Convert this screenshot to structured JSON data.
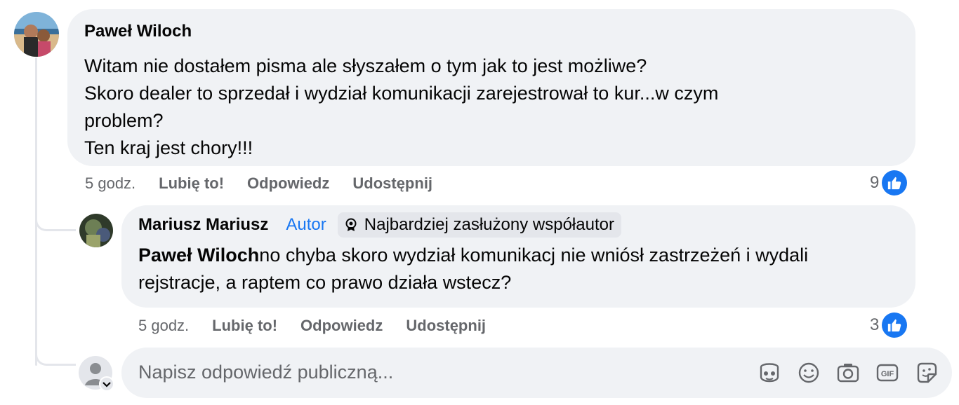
{
  "comment1": {
    "author": "Paweł Wiloch",
    "lines": [
      "Witam nie dostałem pisma ale słyszałem o tym jak to jest możliwe?",
      "Skoro dealer to sprzedał i wydział komunikacji zarejestrował to kur...w czym",
      "problem?",
      "Ten kraj jest chory!!!"
    ],
    "time": "5 godz.",
    "like_label": "Lubię to!",
    "reply_label": "Odpowiedz",
    "share_label": "Udostępnij",
    "like_count": "9"
  },
  "comment2": {
    "author": "Mariusz Mariusz",
    "author_badge": "Autor",
    "contributor_badge": "Najbardziej zasłużony współautor",
    "mention": "Paweł Wiloch",
    "line1_rest": "no chyba skoro wydział komunikacj nie wniósł zastrzeżeń i wydali",
    "line2": "rejstracje, a raptem co prawo działa wstecz?",
    "time": "5 godz.",
    "like_label": "Lubię to!",
    "reply_label": "Odpowiedz",
    "share_label": "Udostępnij",
    "like_count": "3"
  },
  "composer": {
    "placeholder": "Napisz odpowiedź publiczną..."
  },
  "icons": {
    "like": "thumbs-up-icon",
    "avatar_sticker": "avatar-sticker-icon",
    "emoji": "emoji-icon",
    "camera": "camera-icon",
    "gif": "gif-icon",
    "sticker": "sticker-icon"
  },
  "colors": {
    "accent": "#1877f2",
    "bubble": "#f0f2f5",
    "secondary_text": "#65676b"
  }
}
